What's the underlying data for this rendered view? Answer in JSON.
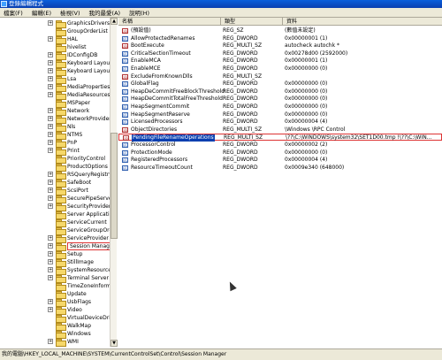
{
  "window": {
    "title": "登錄編輯程式"
  },
  "menu": [
    "檔案(F)",
    "編輯(E)",
    "檢視(V)",
    "我的最愛(A)",
    "說明(H)"
  ],
  "tree": {
    "items": [
      {
        "label": "GraphicsDrivers",
        "expander": "+"
      },
      {
        "label": "GroupOrderList",
        "expander": ""
      },
      {
        "label": "HAL",
        "expander": "+"
      },
      {
        "label": "hivelist",
        "expander": ""
      },
      {
        "label": "IDConfigDB",
        "expander": "+"
      },
      {
        "label": "Keyboard Layout",
        "expander": "+"
      },
      {
        "label": "Keyboard Layouts",
        "expander": "+"
      },
      {
        "label": "Lsa",
        "expander": "+"
      },
      {
        "label": "MediaProperties",
        "expander": "+"
      },
      {
        "label": "MediaResources",
        "expander": "+"
      },
      {
        "label": "MSPaper",
        "expander": ""
      },
      {
        "label": "Network",
        "expander": "+"
      },
      {
        "label": "NetworkProvider",
        "expander": "+"
      },
      {
        "label": "Nls",
        "expander": "+"
      },
      {
        "label": "NTMS",
        "expander": "+"
      },
      {
        "label": "PnP",
        "expander": "+"
      },
      {
        "label": "Print",
        "expander": "+"
      },
      {
        "label": "PriorityControl",
        "expander": ""
      },
      {
        "label": "ProductOptions",
        "expander": ""
      },
      {
        "label": "RSQueryRegistryCt",
        "expander": "+"
      },
      {
        "label": "SafeBoot",
        "expander": "+"
      },
      {
        "label": "ScsiPort",
        "expander": "+"
      },
      {
        "label": "SecurePipeServers",
        "expander": "+"
      },
      {
        "label": "SecurityProviders",
        "expander": "+"
      },
      {
        "label": "Server Applications",
        "expander": ""
      },
      {
        "label": "ServiceCurrent",
        "expander": ""
      },
      {
        "label": "ServiceGroupOrder",
        "expander": ""
      },
      {
        "label": "ServiceProvider",
        "expander": "+"
      },
      {
        "label": "Session Manager",
        "expander": "+",
        "selected": true
      },
      {
        "label": "Setup",
        "expander": "+"
      },
      {
        "label": "StillImage",
        "expander": "+"
      },
      {
        "label": "SystemResources",
        "expander": "+"
      },
      {
        "label": "Terminal Server",
        "expander": "+"
      },
      {
        "label": "TimeZoneInformation",
        "expander": ""
      },
      {
        "label": "Update",
        "expander": ""
      },
      {
        "label": "UsbFlags",
        "expander": "+"
      },
      {
        "label": "Video",
        "expander": "+"
      },
      {
        "label": "VirtualDeviceDrive",
        "expander": ""
      },
      {
        "label": "WalkMap",
        "expander": ""
      },
      {
        "label": "Windows",
        "expander": ""
      },
      {
        "label": "WMI",
        "expander": "+"
      }
    ]
  },
  "list": {
    "headers": {
      "name": "名稱",
      "type": "類型",
      "data": "資料"
    },
    "rows": [
      {
        "name": "(預設值)",
        "type": "REG_SZ",
        "data": "(數值未設定)",
        "icon": "ab"
      },
      {
        "name": "AllowProtectedRenames",
        "type": "REG_DWORD",
        "data": "0x00000001 (1)",
        "icon": "01"
      },
      {
        "name": "BootExecute",
        "type": "REG_MULTI_SZ",
        "data": "autocheck autochk *",
        "icon": "ab"
      },
      {
        "name": "CriticalSectionTimeout",
        "type": "REG_DWORD",
        "data": "0x00278d00 (2592000)",
        "icon": "01"
      },
      {
        "name": "EnableMCA",
        "type": "REG_DWORD",
        "data": "0x00000001 (1)",
        "icon": "01"
      },
      {
        "name": "EnableMCE",
        "type": "REG_DWORD",
        "data": "0x00000000 (0)",
        "icon": "01"
      },
      {
        "name": "ExcludeFromKnownDlls",
        "type": "REG_MULTI_SZ",
        "data": "",
        "icon": "ab"
      },
      {
        "name": "GlobalFlag",
        "type": "REG_DWORD",
        "data": "0x00000000 (0)",
        "icon": "01"
      },
      {
        "name": "HeapDeCommitFreeBlockThreshold",
        "type": "REG_DWORD",
        "data": "0x00000000 (0)",
        "icon": "01"
      },
      {
        "name": "HeapDeCommitTotalFreeThreshold",
        "type": "REG_DWORD",
        "data": "0x00000000 (0)",
        "icon": "01"
      },
      {
        "name": "HeapSegmentCommit",
        "type": "REG_DWORD",
        "data": "0x00000000 (0)",
        "icon": "01"
      },
      {
        "name": "HeapSegmentReserve",
        "type": "REG_DWORD",
        "data": "0x00000000 (0)",
        "icon": "01"
      },
      {
        "name": "LicensedProcessors",
        "type": "REG_DWORD",
        "data": "0x00000004 (4)",
        "icon": "01"
      },
      {
        "name": "ObjectDirectories",
        "type": "REG_MULTI_SZ",
        "data": "\\Windows \\RPC Control",
        "icon": "ab"
      },
      {
        "name": "PendingFileRenameOperations",
        "type": "REG_MULTI_SZ",
        "data": "\\??\\C:\\WINDOWS\\system32\\SET1D00.tmp !\\??\\C:\\WIN...",
        "icon": "ab",
        "highlight": true
      },
      {
        "name": "ProcessorControl",
        "type": "REG_DWORD",
        "data": "0x00000002 (2)",
        "icon": "01"
      },
      {
        "name": "ProtectionMode",
        "type": "REG_DWORD",
        "data": "0x00000000 (0)",
        "icon": "01"
      },
      {
        "name": "RegisteredProcessors",
        "type": "REG_DWORD",
        "data": "0x00000004 (4)",
        "icon": "01"
      },
      {
        "name": "ResourceTimeoutCount",
        "type": "REG_DWORD",
        "data": "0x0009e340 (648000)",
        "icon": "01"
      }
    ]
  },
  "statusbar": {
    "path": "我的電腦\\HKEY_LOCAL_MACHINE\\SYSTEM\\CurrentControlSet\\Control\\Session Manager"
  }
}
